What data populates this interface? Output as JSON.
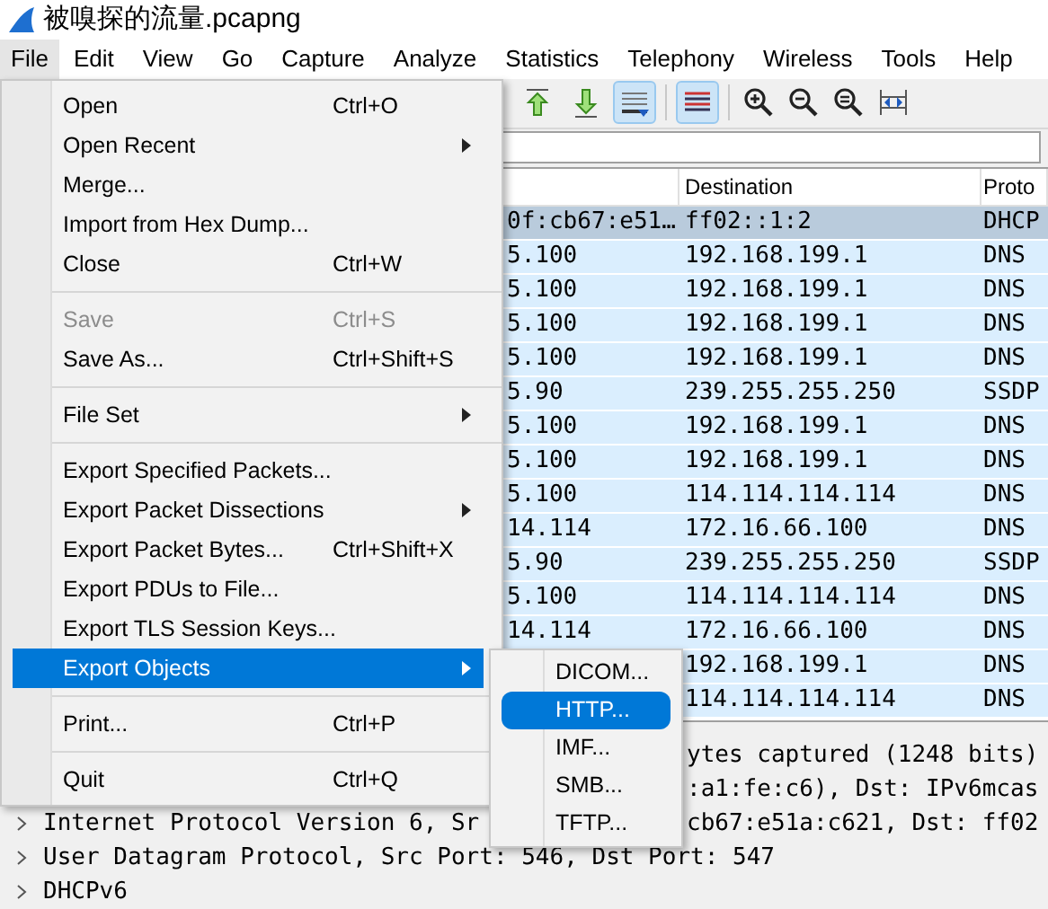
{
  "window": {
    "title": "被嗅探的流量.pcapng"
  },
  "menubar": [
    {
      "label": "File",
      "selected": true
    },
    {
      "label": "Edit",
      "selected": false
    },
    {
      "label": "View",
      "selected": false
    },
    {
      "label": "Go",
      "selected": false
    },
    {
      "label": "Capture",
      "selected": false
    },
    {
      "label": "Analyze",
      "selected": false
    },
    {
      "label": "Statistics",
      "selected": false
    },
    {
      "label": "Telephony",
      "selected": false
    },
    {
      "label": "Wireless",
      "selected": false
    },
    {
      "label": "Tools",
      "selected": false
    },
    {
      "label": "Help",
      "selected": false
    }
  ],
  "toolbar": [
    {
      "kind": "partial"
    },
    {
      "kind": "first"
    },
    {
      "kind": "last"
    },
    {
      "kind": "autoscroll",
      "selected": true
    },
    {
      "kind": "sep"
    },
    {
      "kind": "colorize",
      "selected": true
    },
    {
      "kind": "sep"
    },
    {
      "kind": "zoom-in"
    },
    {
      "kind": "zoom-out"
    },
    {
      "kind": "zoom-normal"
    },
    {
      "kind": "resize"
    }
  ],
  "packet_list": {
    "columns": [
      null,
      "Destination",
      "Proto"
    ],
    "rows": [
      {
        "source": "0f:cb67:e51…",
        "destination": "ff02::1:2",
        "protocol": "DHCP",
        "selected": true
      },
      {
        "source": "5.100",
        "destination": "192.168.199.1",
        "protocol": "DNS",
        "selected": false
      },
      {
        "source": "5.100",
        "destination": "192.168.199.1",
        "protocol": "DNS",
        "selected": false
      },
      {
        "source": "5.100",
        "destination": "192.168.199.1",
        "protocol": "DNS",
        "selected": false
      },
      {
        "source": "5.100",
        "destination": "192.168.199.1",
        "protocol": "DNS",
        "selected": false
      },
      {
        "source": "5.90",
        "destination": "239.255.255.250",
        "protocol": "SSDP",
        "selected": false
      },
      {
        "source": "5.100",
        "destination": "192.168.199.1",
        "protocol": "DNS",
        "selected": false
      },
      {
        "source": "5.100",
        "destination": "192.168.199.1",
        "protocol": "DNS",
        "selected": false
      },
      {
        "source": "5.100",
        "destination": "114.114.114.114",
        "protocol": "DNS",
        "selected": false
      },
      {
        "source": "14.114",
        "destination": "172.16.66.100",
        "protocol": "DNS",
        "selected": false
      },
      {
        "source": "5.90",
        "destination": "239.255.255.250",
        "protocol": "SSDP",
        "selected": false
      },
      {
        "source": "5.100",
        "destination": "114.114.114.114",
        "protocol": "DNS",
        "selected": false
      },
      {
        "source": "14.114",
        "destination": "172.16.66.100",
        "protocol": "DNS",
        "selected": false
      },
      {
        "destination": "192.168.199.1",
        "protocol": "DNS",
        "selected": false
      },
      {
        "destination": "114.114.114.114",
        "protocol": "DNS",
        "selected": false
      }
    ]
  },
  "details": [
    {
      "tail": "ytes captured (1248 bits)"
    },
    {
      "tail": ":a1:fe:c6), Dst: IPv6mcas"
    },
    {
      "head": "Internet Protocol Version 6, Sr",
      "tail": "cb67:e51a:c621, Dst: ff02"
    },
    {
      "head": "User Datagram Protocol, Src Port: 546, Dst Port: 547"
    },
    {
      "head": "DHCPv6"
    }
  ],
  "file_menu": [
    {
      "kind": "item",
      "label": "Open",
      "shortcut": "Ctrl+O",
      "submenu": false,
      "disabled": false,
      "selected": false
    },
    {
      "kind": "item",
      "label": "Open Recent",
      "submenu": true,
      "disabled": false,
      "selected": false
    },
    {
      "kind": "item",
      "label": "Merge...",
      "submenu": false,
      "disabled": false,
      "selected": false
    },
    {
      "kind": "item",
      "label": "Import from Hex Dump...",
      "submenu": false,
      "disabled": false,
      "selected": false
    },
    {
      "kind": "item",
      "label": "Close",
      "shortcut": "Ctrl+W",
      "submenu": false,
      "disabled": false,
      "selected": false
    },
    {
      "kind": "separator"
    },
    {
      "kind": "item",
      "label": "Save",
      "shortcut": "Ctrl+S",
      "submenu": false,
      "disabled": true,
      "selected": false
    },
    {
      "kind": "item",
      "label": "Save As...",
      "shortcut": "Ctrl+Shift+S",
      "submenu": false,
      "disabled": false,
      "selected": false
    },
    {
      "kind": "separator"
    },
    {
      "kind": "item",
      "label": "File Set",
      "submenu": true,
      "disabled": false,
      "selected": false
    },
    {
      "kind": "separator"
    },
    {
      "kind": "item",
      "label": "Export Specified Packets...",
      "submenu": false,
      "disabled": false,
      "selected": false
    },
    {
      "kind": "item",
      "label": "Export Packet Dissections",
      "submenu": true,
      "disabled": false,
      "selected": false
    },
    {
      "kind": "item",
      "label": "Export Packet Bytes...",
      "shortcut": "Ctrl+Shift+X",
      "submenu": false,
      "disabled": false,
      "selected": false
    },
    {
      "kind": "item",
      "label": "Export PDUs to File...",
      "submenu": false,
      "disabled": false,
      "selected": false
    },
    {
      "kind": "item",
      "label": "Export TLS Session Keys...",
      "submenu": false,
      "disabled": false,
      "selected": false
    },
    {
      "kind": "item",
      "label": "Export Objects",
      "submenu": true,
      "disabled": false,
      "selected": true
    },
    {
      "kind": "separator"
    },
    {
      "kind": "item",
      "label": "Print...",
      "shortcut": "Ctrl+P",
      "submenu": false,
      "disabled": false,
      "selected": false
    },
    {
      "kind": "separator"
    },
    {
      "kind": "item",
      "label": "Quit",
      "shortcut": "Ctrl+Q",
      "submenu": false,
      "disabled": false,
      "selected": false
    }
  ],
  "export_objects_menu": [
    {
      "label": "DICOM...",
      "selected": false
    },
    {
      "label": "HTTP...",
      "selected": true
    },
    {
      "label": "IMF...",
      "selected": false
    },
    {
      "label": "SMB...",
      "selected": false
    },
    {
      "label": "TFTP...",
      "selected": false
    }
  ]
}
